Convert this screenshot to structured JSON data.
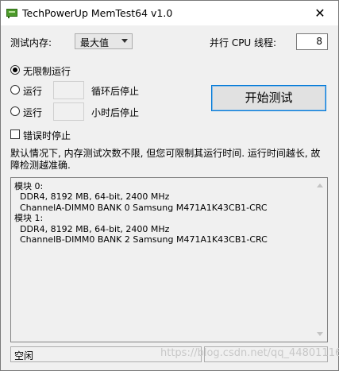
{
  "window": {
    "title": "TechPowerUp MemTest64 v1.0",
    "close_glyph": "✕",
    "icon": "memory-stick-icon"
  },
  "settings": {
    "memory_label": "测试内存:",
    "memory_value": "最大值",
    "threads_label": "并行 CPU 线程:",
    "threads_value": "8"
  },
  "modes": {
    "unlimited_label": "无限制运行",
    "run_label": "运行",
    "loops_suffix": "循环后停止",
    "hours_suffix": "小时后停止"
  },
  "start_button": "开始测试",
  "stop_on_error_label": "错误时停止",
  "info_text": "默认情况下, 内存测试次数不限, 但您可限制其运行时间. 运行时间越长, 故障检测越准确.",
  "modules": [
    {
      "header": "模块 0:",
      "spec": "DDR4, 8192 MB, 64-bit, 2400 MHz",
      "slot": "ChannelA-DIMM0 BANK 0 Samsung M471A1K43CB1-CRC"
    },
    {
      "header": "模块 1:",
      "spec": "DDR4, 8192 MB, 64-bit, 2400 MHz",
      "slot": "ChannelB-DIMM0 BANK 2 Samsung M471A1K43CB1-CRC"
    }
  ],
  "status": {
    "text": "空闲"
  },
  "watermark": "https://blog.csdn.net/qq_44801116"
}
